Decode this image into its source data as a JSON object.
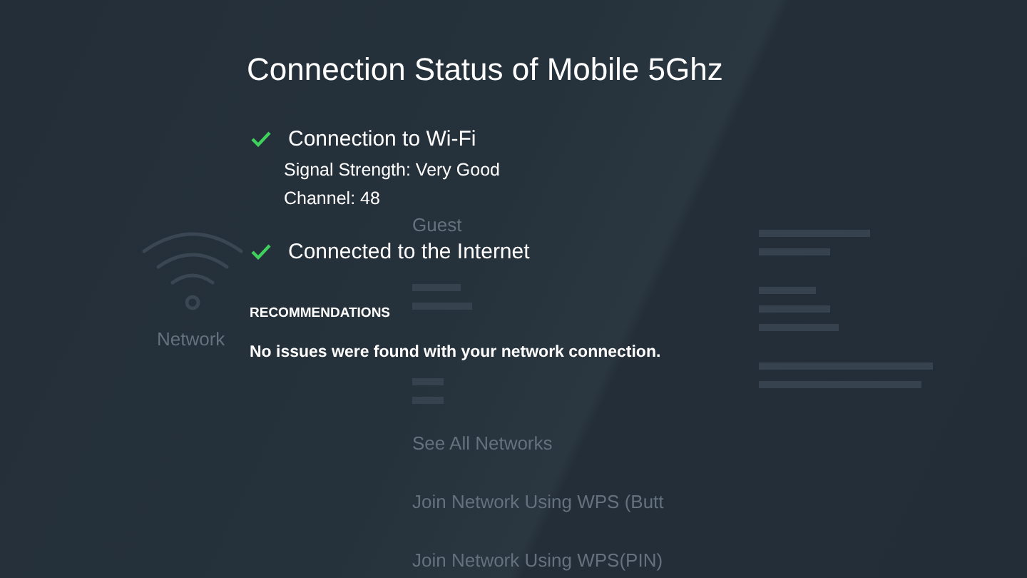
{
  "background": {
    "network_label": "Network",
    "guest_label": "Guest",
    "menu_items": [
      "See All Networks",
      "Join Network Using WPS (Butt",
      "Join Network Using WPS(PIN)"
    ]
  },
  "dialog": {
    "title": "Connection Status of Mobile 5Ghz",
    "checks": [
      {
        "label": "Connection to Wi-Fi",
        "ok": true,
        "details": [
          "Signal Strength: Very Good",
          "Channel: 48"
        ]
      },
      {
        "label": "Connected to the Internet",
        "ok": true
      }
    ],
    "recommendations": {
      "heading": "RECOMMENDATIONS",
      "message": "No issues were found with your network connection."
    }
  }
}
